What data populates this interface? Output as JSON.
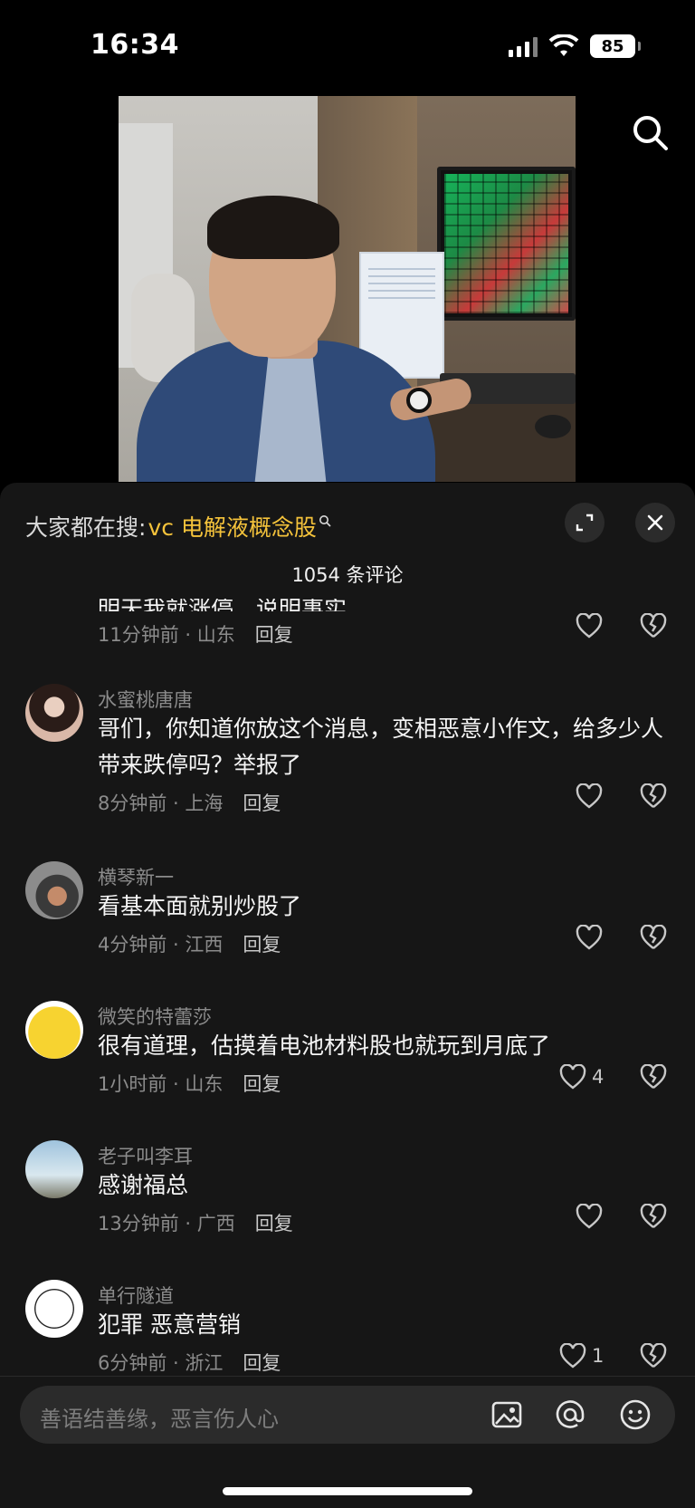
{
  "status_bar": {
    "time": "16:34",
    "battery": "85"
  },
  "media": {
    "description_icon": "search-icon"
  },
  "panel": {
    "search_prefix": "大家都在搜:",
    "search_keyword": "vc 电解液概念股",
    "comment_count": "1054 条评论",
    "partial_text": "明天我就涨停，说明事实"
  },
  "comments": [
    {
      "name": "",
      "text": "",
      "time": "11分钟前 · 山东",
      "reply": "回复",
      "likes": ""
    },
    {
      "name": "水蜜桃唐唐",
      "text": "哥们，你知道你放这个消息，变相恶意小作文，给多少人带来跌停吗？举报了",
      "time": "8分钟前 · 上海",
      "reply": "回复",
      "likes": ""
    },
    {
      "name": "横琴新一",
      "text": "看基本面就别炒股了",
      "time": "4分钟前 · 江西",
      "reply": "回复",
      "likes": ""
    },
    {
      "name": "微笑的特蕾莎",
      "text": "很有道理，估摸着电池材料股也就玩到月底了",
      "time": "1小时前 · 山东",
      "reply": "回复",
      "likes": "4"
    },
    {
      "name": "老子叫李耳",
      "text": "感谢福总",
      "time": "13分钟前 · 广西",
      "reply": "回复",
      "likes": ""
    },
    {
      "name": "单行隧道",
      "text": "犯罪 恶意营销",
      "time": "6分钟前 · 浙江",
      "reply": "回复",
      "likes": "1"
    }
  ],
  "input": {
    "placeholder": "善语结善缘，恶言伤人心"
  },
  "colors": {
    "keyword": "#f5c33b",
    "panel_bg": "#161616",
    "input_bg": "#2b2b2b"
  }
}
